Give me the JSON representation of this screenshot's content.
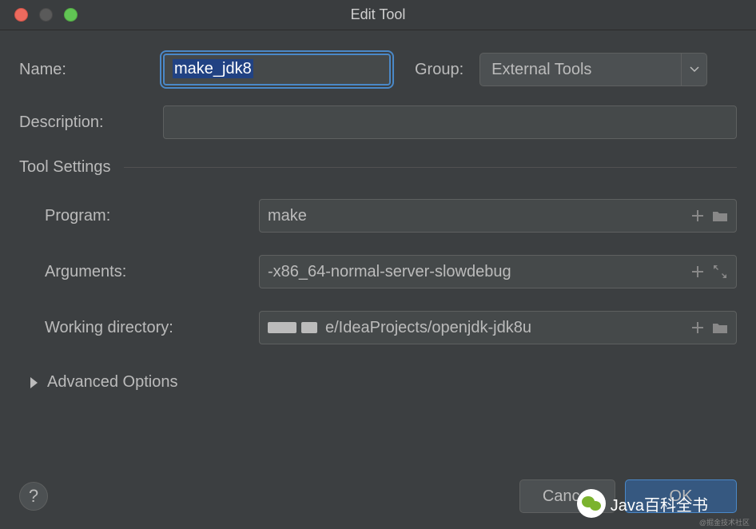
{
  "titlebar": {
    "title": "Edit Tool"
  },
  "fields": {
    "name_label": "Name:",
    "name_value": "make_jdk8",
    "group_label": "Group:",
    "group_value": "External Tools",
    "description_label": "Description:",
    "description_value": ""
  },
  "tool_settings": {
    "header": "Tool Settings",
    "program_label": "Program:",
    "program_value": "make",
    "arguments_label": "Arguments:",
    "arguments_value": "-x86_64-normal-server-slowdebug",
    "workdir_label": "Working directory:",
    "workdir_value": "e/IdeaProjects/openjdk-jdk8u"
  },
  "advanced": {
    "label": "Advanced Options"
  },
  "footer": {
    "help": "?",
    "cancel": "Cancel",
    "ok": "OK"
  },
  "watermark": {
    "text": "Java百科全书",
    "sub": "@掘金技术社区"
  }
}
